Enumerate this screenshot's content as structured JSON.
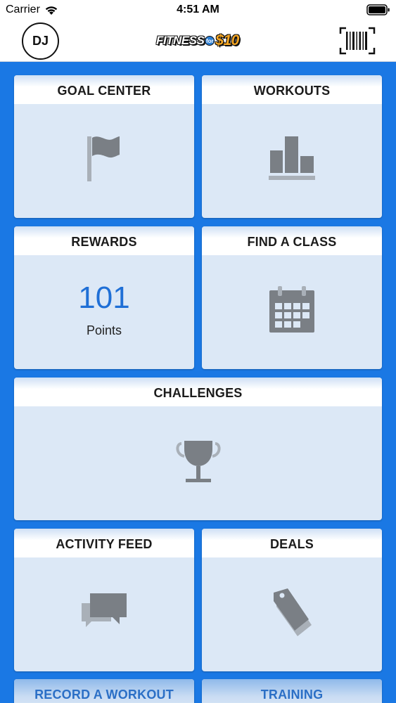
{
  "status_bar": {
    "carrier": "Carrier",
    "time": "4:51 AM"
  },
  "header": {
    "avatar_initials": "DJ",
    "logo": {
      "fitness": "FITNESS",
      "for": "for",
      "price": "$10"
    },
    "barcode_icon": "barcode-icon"
  },
  "tiles": [
    {
      "title": "GOAL CENTER",
      "icon": "flag-icon"
    },
    {
      "title": "WORKOUTS",
      "icon": "bar-chart-icon"
    },
    {
      "title": "REWARDS",
      "value": "101",
      "unit": "Points"
    },
    {
      "title": "FIND A CLASS",
      "icon": "calendar-icon"
    },
    {
      "title": "CHALLENGES",
      "icon": "trophy-icon"
    },
    {
      "title": "ACTIVITY FEED",
      "icon": "chat-bubbles-icon"
    },
    {
      "title": "DEALS",
      "icon": "tag-icon"
    },
    {
      "title": "RECORD A WORKOUT"
    },
    {
      "title": "TRAINING"
    }
  ],
  "colors": {
    "background": "#1a78e4",
    "tile": "#dce8f6",
    "icon": "#7a7f85",
    "accent": "#1f6fd6"
  }
}
